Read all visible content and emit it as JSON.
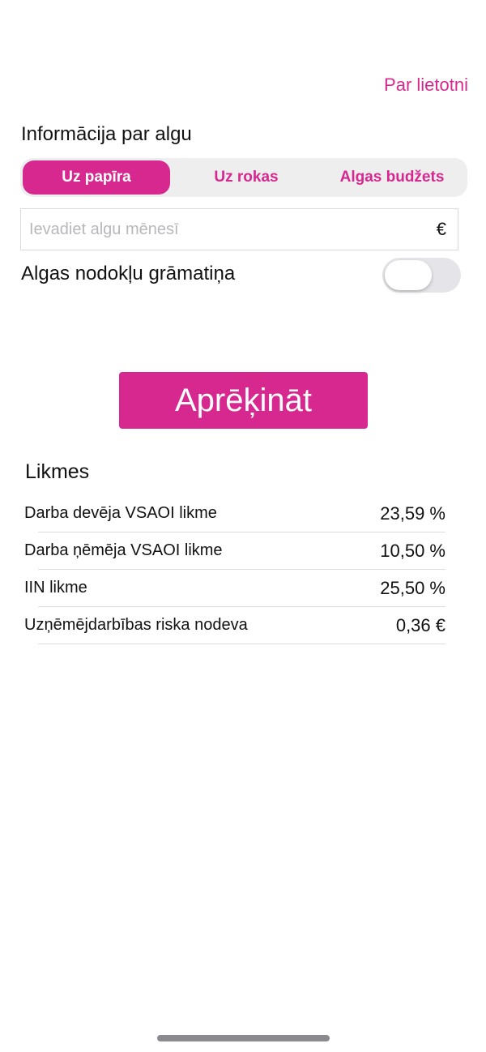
{
  "header": {
    "about_link": "Par lietotni"
  },
  "salary_info": {
    "heading": "Informācija par algu",
    "tabs": [
      {
        "label": "Uz papīra",
        "selected": true
      },
      {
        "label": "Uz rokas",
        "selected": false
      },
      {
        "label": "Algas budžets",
        "selected": false
      }
    ],
    "salary_input": {
      "value": "",
      "placeholder": "Ievadiet algu mēnesī",
      "currency_suffix": "€"
    },
    "tax_book_toggle": {
      "label": "Algas nodokļu grāmatiņa",
      "on": false
    }
  },
  "calculate_button": {
    "label": "Aprēķināt"
  },
  "rates": {
    "title": "Likmes",
    "rows": [
      {
        "label": "Darba devēja VSAOI likme",
        "value": "23,59 %"
      },
      {
        "label": "Darba ņēmēja VSAOI likme",
        "value": "10,50 %"
      },
      {
        "label": "IIN likme",
        "value": "25,50 %"
      },
      {
        "label": "Uzņēmējdarbības riska nodeva",
        "value": "0,36 €"
      }
    ]
  },
  "colors": {
    "accent": "#d6288f",
    "segment_background": "#eeeeef",
    "toggle_off": "#e5e5e9",
    "divider": "#dddddd"
  }
}
